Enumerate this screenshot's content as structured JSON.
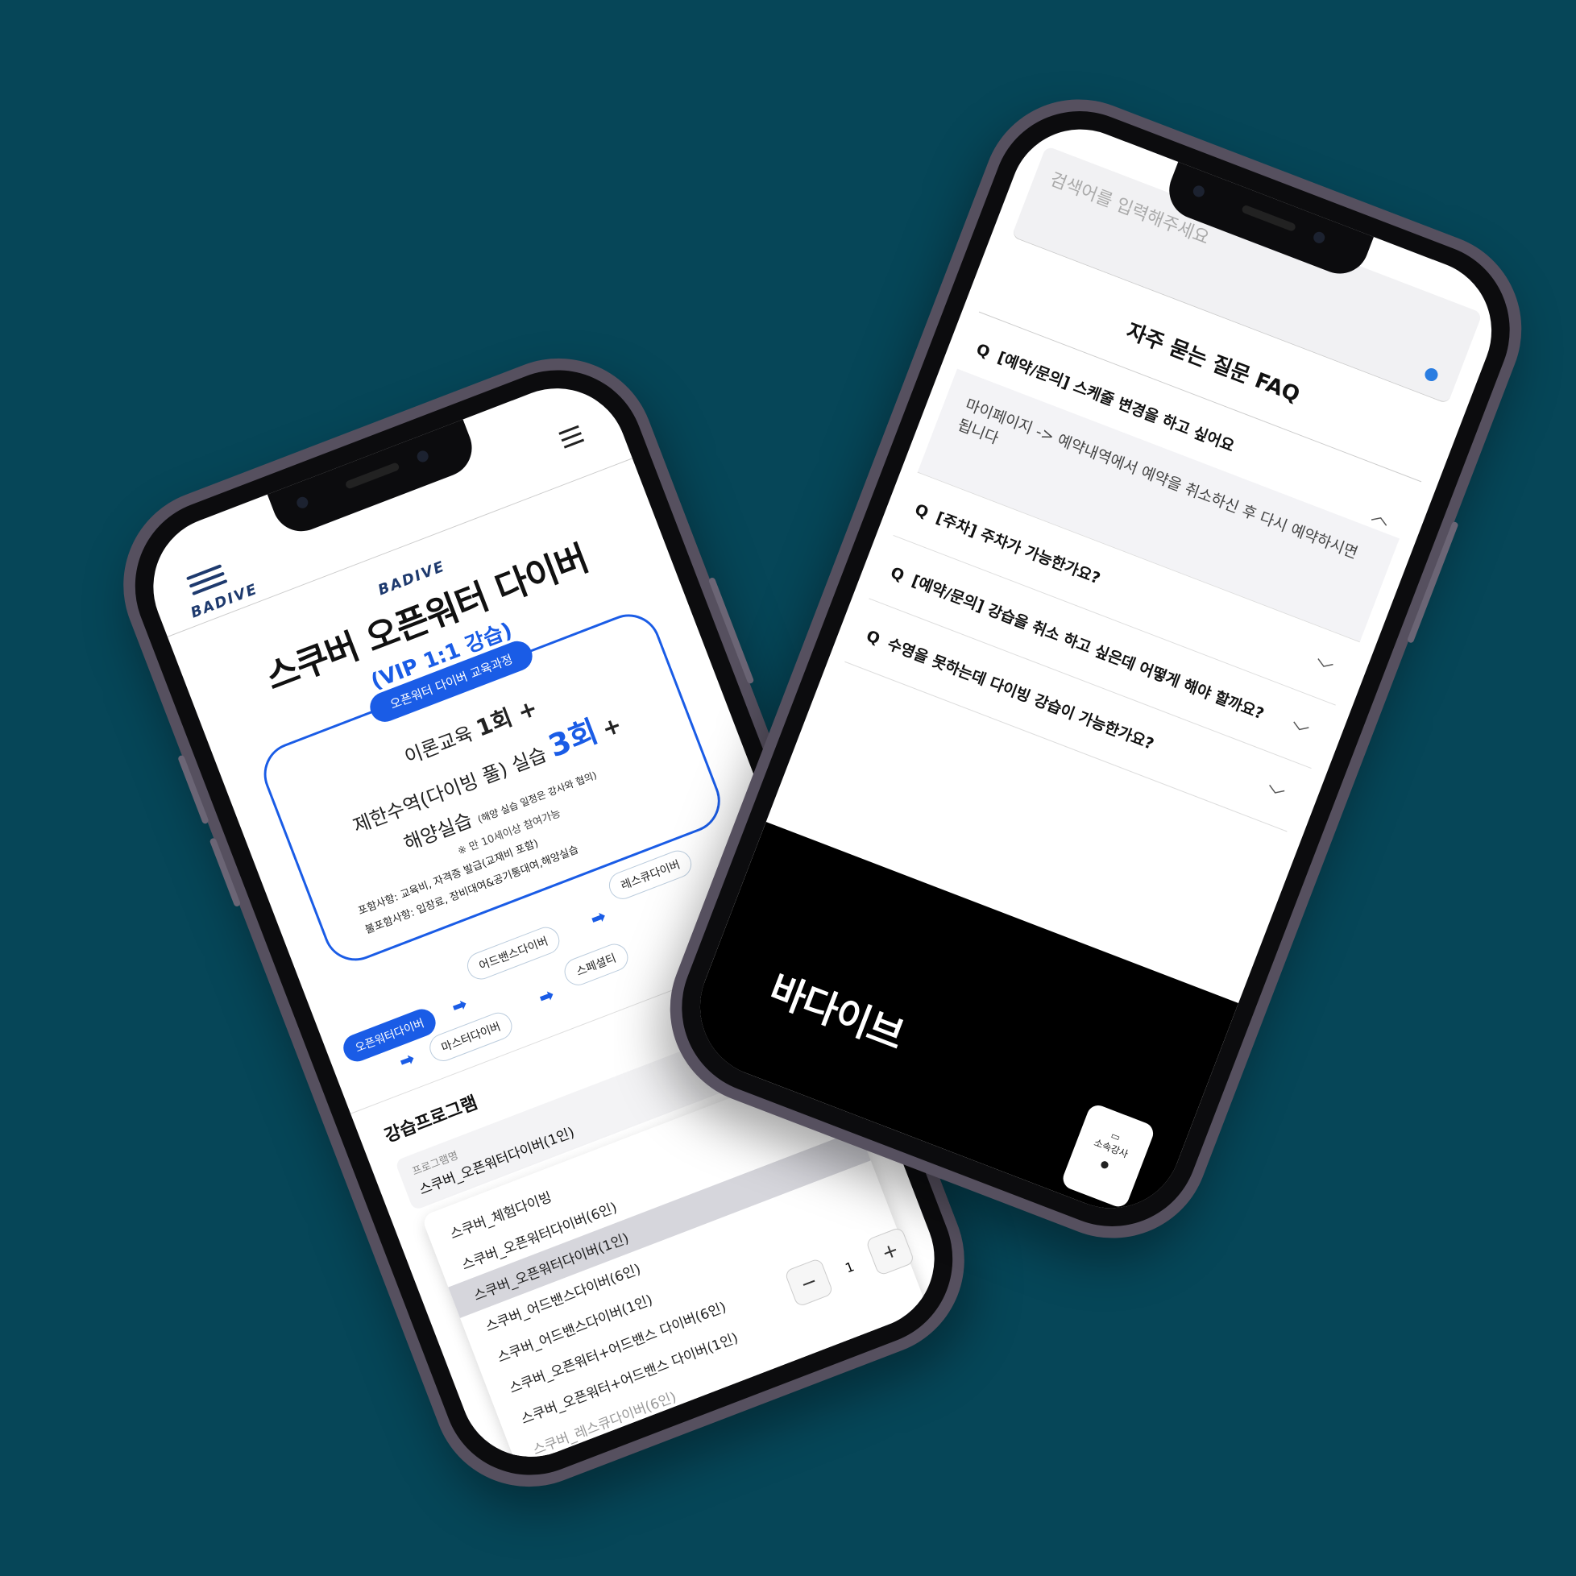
{
  "left_phone": {
    "logo_text": "BADIVE",
    "poster": {
      "brand": "BADIVE",
      "title": "스쿠버 오픈워터 다이버",
      "subtitle": "(VIP 1:1 강습)",
      "pill": "오픈워터 다이버 교육과정",
      "line1_prefix": "이론교육",
      "line1_strong": "1회 +",
      "line2_prefix": "제한수역(다이빙 풀) 실습",
      "line2_strong": "3회",
      "line2_suffix": "+",
      "line3": "해양실습",
      "line3_note": "(해양 실습 일정은 강사와 협의)",
      "note": "※ 만 10세이상 참여가능",
      "included": "포함사항: 교육비, 자격증 발급(교재비 포함)",
      "excluded": "불포함사항: 입장료, 장비대여&공기통대여,해양실습",
      "flow": [
        "오픈워터다이버",
        "어드밴스다이버",
        "레스큐다이버",
        "마스터다이버",
        "스페셜티"
      ]
    },
    "program_section": {
      "title": "강습프로그램",
      "field_label": "프로그램명",
      "field_value": "스쿠버_오픈워터다이버(1인)",
      "options": [
        "스쿠버_체험다이빙",
        "스쿠버_오픈워터다이버(6인)",
        "스쿠버_오픈워터다이버(1인)",
        "스쿠버_어드밴스다이버(6인)",
        "스쿠버_어드밴스다이버(1인)",
        "스쿠버_오픈워터+어드밴스 다이버(6인)",
        "스쿠버_오픈워터+어드밴스 다이버(1인)",
        "스쿠버_레스큐다이버(6인)"
      ],
      "selected_index": 2,
      "quantity": "1",
      "minus": "−",
      "plus": "+"
    }
  },
  "right_phone": {
    "search_placeholder": "검색어를 입력해주세요",
    "faq_title": "자주 묻는 질문 FAQ",
    "faq": [
      {
        "q": "[예약/문의] 스케줄 변경을 하고 싶어요",
        "a": "마이페이지 -> 예약내역에서 예약을 취소하신 후 다시 예약하시면 됩니다",
        "open": true
      },
      {
        "q": "[주차] 주차가 가능한가요?",
        "open": false
      },
      {
        "q": "[예약/문의] 강습을 취소 하고 싶은데 어떻게 해야 할까요?",
        "open": false
      },
      {
        "q": "수영을 못하는데 다이빙 강습이 가능한가요?",
        "open": false
      }
    ],
    "q_mark": "Q",
    "footer_brand": "바다이브",
    "float_label": "소속강사"
  }
}
